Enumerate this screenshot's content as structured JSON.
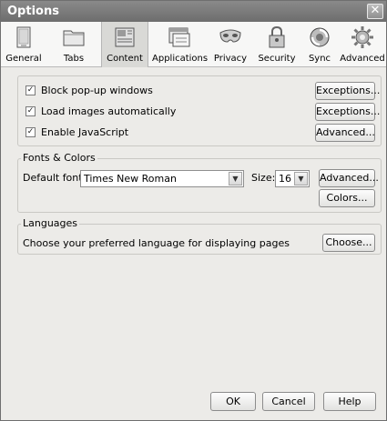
{
  "window": {
    "title": "Options",
    "close_glyph": "✕"
  },
  "toolbar": {
    "items": [
      {
        "label": "General",
        "icon": "general-icon"
      },
      {
        "label": "Tabs",
        "icon": "tabs-icon"
      },
      {
        "label": "Content",
        "icon": "content-icon",
        "selected": true
      },
      {
        "label": "Applications",
        "icon": "applications-icon"
      },
      {
        "label": "Privacy",
        "icon": "privacy-icon"
      },
      {
        "label": "Security",
        "icon": "security-icon"
      },
      {
        "label": "Sync",
        "icon": "sync-icon"
      },
      {
        "label": "Advanced",
        "icon": "advanced-icon"
      }
    ]
  },
  "content": {
    "block_popups": {
      "label": "Block pop-up windows",
      "checked": true,
      "button": "Exceptions..."
    },
    "load_images": {
      "label": "Load images automatically",
      "checked": true,
      "button": "Exceptions..."
    },
    "enable_js": {
      "label": "Enable JavaScript",
      "checked": true,
      "button": "Advanced..."
    },
    "check_glyph": "✓"
  },
  "fonts": {
    "caption": "Fonts & Colors",
    "default_font_label": "Default font:",
    "default_font_value": "Times New Roman",
    "size_label": "Size:",
    "size_value": "16",
    "advanced_button": "Advanced...",
    "colors_button": "Colors...",
    "dropdown_glyph": "▼"
  },
  "languages": {
    "caption": "Languages",
    "description": "Choose your preferred language for displaying pages",
    "choose_button": "Choose..."
  },
  "footer": {
    "ok": "OK",
    "cancel": "Cancel",
    "help": "Help"
  }
}
